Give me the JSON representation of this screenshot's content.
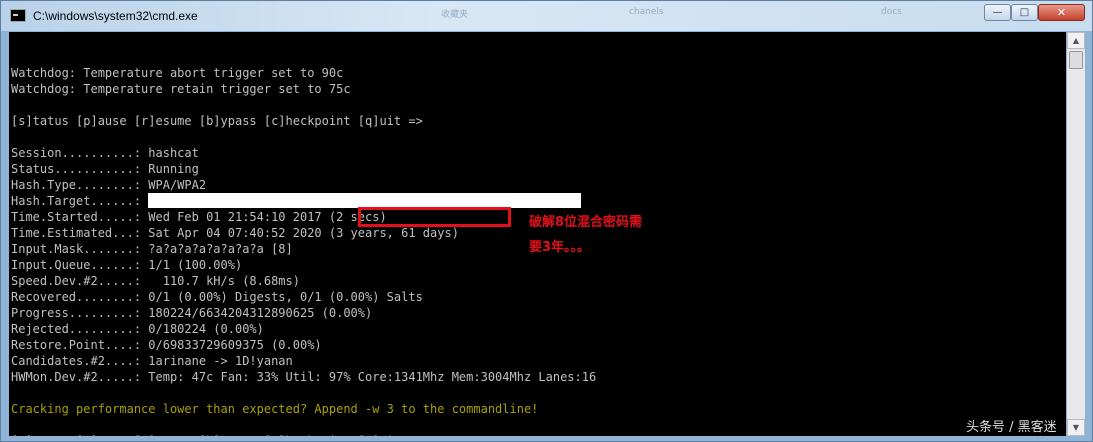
{
  "window": {
    "title": "C:\\windows\\system32\\cmd.exe",
    "min_label": "—",
    "max_label": "□",
    "close_label": "✕"
  },
  "background_tabs": [
    "收藏夹",
    "chanels",
    "docs"
  ],
  "console": {
    "lines": [
      {
        "text": "",
        "style": "normal"
      },
      {
        "text": "Watchdog: Temperature abort trigger set to 90c",
        "style": "normal"
      },
      {
        "text": "Watchdog: Temperature retain trigger set to 75c",
        "style": "normal"
      },
      {
        "text": "",
        "style": "normal"
      },
      {
        "text": "[s]tatus [p]ause [r]esume [b]ypass [c]heckpoint [q]uit =>",
        "style": "normal"
      },
      {
        "text": "",
        "style": "normal"
      },
      {
        "text": "Session..........: hashcat",
        "style": "normal"
      },
      {
        "text": "Status...........: Running",
        "style": "normal"
      },
      {
        "text": "Hash.Type........: WPA/WPA2",
        "style": "normal"
      },
      {
        "text": "Hash.Target......: ",
        "style": "redacted"
      },
      {
        "text": "Time.Started.....: Wed Feb 01 21:54:10 2017 (2 secs)",
        "style": "normal"
      },
      {
        "text": "Time.Estimated...: Sat Apr 04 07:40:52 2020 (3 years, 61 days)",
        "style": "normal"
      },
      {
        "text": "Input.Mask.......: ?a?a?a?a?a?a?a?a [8]",
        "style": "normal"
      },
      {
        "text": "Input.Queue......: 1/1 (100.00%)",
        "style": "normal"
      },
      {
        "text": "Speed.Dev.#2.....:   110.7 kH/s (8.68ms)",
        "style": "normal"
      },
      {
        "text": "Recovered........: 0/1 (0.00%) Digests, 0/1 (0.00%) Salts",
        "style": "normal"
      },
      {
        "text": "Progress.........: 180224/6634204312890625 (0.00%)",
        "style": "normal"
      },
      {
        "text": "Rejected.........: 0/180224 (0.00%)",
        "style": "normal"
      },
      {
        "text": "Restore.Point....: 0/69833729609375 (0.00%)",
        "style": "normal"
      },
      {
        "text": "Candidates.#2....: 1arinane -> 1D!yanan",
        "style": "normal"
      },
      {
        "text": "HWMon.Dev.#2.....: Temp: 47c Fan: 33% Util: 97% Core:1341Mhz Mem:3004Mhz Lanes:16",
        "style": "normal"
      },
      {
        "text": "",
        "style": "normal"
      },
      {
        "text": "Cracking performance lower than expected? Append -w 3 to the commandline!",
        "style": "yellow"
      },
      {
        "text": "",
        "style": "normal"
      },
      {
        "text": "[s]tatus [p]ause [r]esume [b]ypass [c]heckpoint [q]uit => ",
        "style": "prompt"
      }
    ]
  },
  "annotation": {
    "line1": "破解8位混合密码需",
    "line2": "要3年。。。",
    "color": "#e3101a"
  },
  "watermark": "头条号 / 黑客迷"
}
